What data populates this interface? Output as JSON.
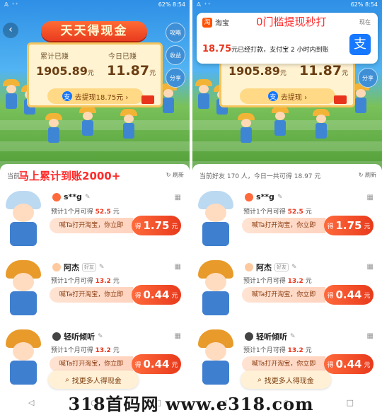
{
  "status": {
    "signal": "𝔸 ⁺⁺",
    "battery": "62%",
    "time": "8:54"
  },
  "left": {
    "back_label": "‹",
    "side_buttons": [
      "攻略",
      "收益",
      "分享"
    ],
    "banner": "天天得现金",
    "earned_total_label": "累计已赚",
    "earned_total_value": "1905.89",
    "earned_today_label": "今日已赚",
    "earned_today_value": "11.87",
    "unit": "元",
    "withdraw_label": "去提现18.75元 ›",
    "overlay_caption": "马上累计到账2000+",
    "list_header": "当前",
    "refresh_label": "刷新"
  },
  "right": {
    "notification": {
      "app_name": "淘宝",
      "headline": "0门槛提现秒打",
      "time": "现在",
      "amount": "18.75",
      "message": "元已经打款，支付宝 2 小时内到账",
      "logo_label": "支"
    },
    "earned_total_value": "1905.89",
    "earned_today_value": "11.87",
    "unit": "元",
    "withdraw_label": "去提现 ›",
    "side_button": "分享",
    "list_header": "当前好友 170 人，今日一共可得 18.97 元",
    "refresh_label": "刷新"
  },
  "friends": [
    {
      "name": "s**g",
      "tag": "",
      "sub_prefix": "预计1个月可得",
      "amount": "52.5",
      "unit": "元",
      "action": "喊Ta打开淘宝，你立即",
      "get_prefix": "得",
      "get_value": "1.75",
      "get_unit": "元"
    },
    {
      "name": "阿杰",
      "tag": "好友",
      "sub_prefix": "预计1个月可得",
      "amount": "13.2",
      "unit": "元",
      "action": "喊Ta打开淘宝，你立即",
      "get_prefix": "得",
      "get_value": "0.44",
      "get_unit": "元"
    },
    {
      "name": "轻听倾听",
      "tag": "",
      "sub_prefix": "预计1个月可得",
      "amount": "13.2",
      "unit": "元",
      "action": "喊Ta打开淘宝，你立即",
      "get_prefix": "得",
      "get_value": "0.44",
      "get_unit": "元"
    }
  ],
  "find_more_label": "找更多人得现金",
  "nav": [
    "◁",
    "○",
    "□"
  ],
  "watermark": "318首码网  www.e318.com",
  "colors": {
    "accent_red": "#e8341c",
    "taobao_orange": "#ff5000",
    "alipay_blue": "#1677ff"
  }
}
